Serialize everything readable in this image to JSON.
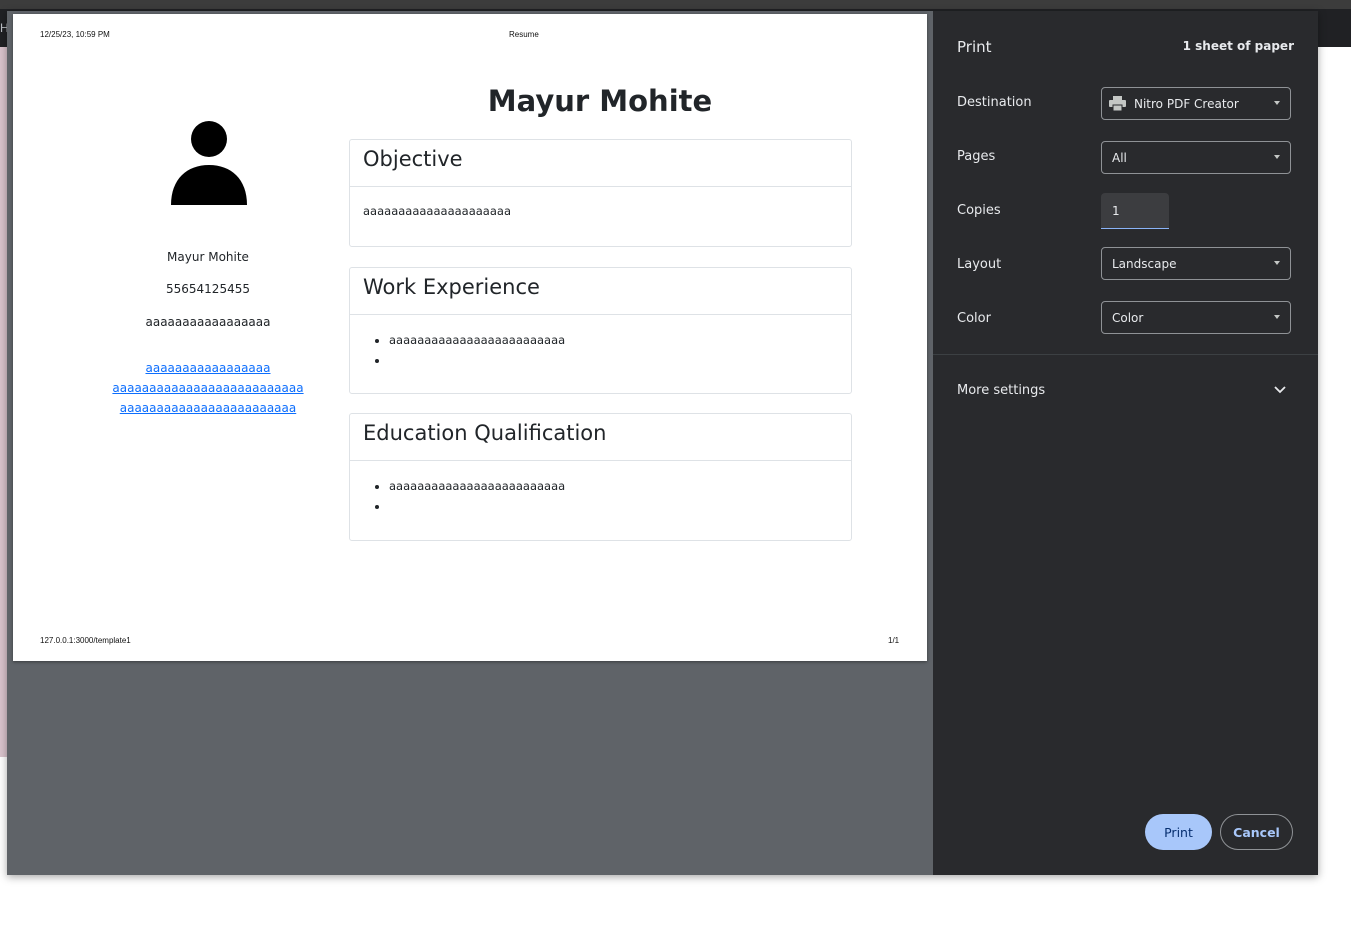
{
  "background": {
    "tab_fragment": "Hu"
  },
  "preview": {
    "header_date": "12/25/23, 10:59 PM",
    "header_title": "Resume",
    "footer_url": "127.0.0.1:3000/template1",
    "footer_page": "1/1",
    "resume": {
      "heading": "Mayur Mohite",
      "side_name": "Mayur Mohite",
      "phone": "55654125455",
      "side_text": "aaaaaaaaaaaaaaaaa",
      "links": [
        "aaaaaaaaaaaaaaaaa",
        "aaaaaaaaaaaaaaaaaaaaaaaaaa",
        "aaaaaaaaaaaaaaaaaaaaaaaa"
      ],
      "objective": {
        "title": "Objective",
        "text": "aaaaaaaaaaaaaaaaaaaaa"
      },
      "work": {
        "title": "Work Experience",
        "items": [
          "aaaaaaaaaaaaaaaaaaaaaaaaa",
          ""
        ]
      },
      "education": {
        "title": "Education Qualification",
        "items": [
          "aaaaaaaaaaaaaaaaaaaaaaaaa",
          ""
        ]
      }
    }
  },
  "panel": {
    "title": "Print",
    "sheets": "1 sheet of paper",
    "destination": {
      "label": "Destination",
      "value": "Nitro PDF Creator",
      "icon": "printer-icon"
    },
    "pages": {
      "label": "Pages",
      "value": "All"
    },
    "copies": {
      "label": "Copies",
      "value": "1"
    },
    "layout": {
      "label": "Layout",
      "value": "Landscape"
    },
    "color": {
      "label": "Color",
      "value": "Color"
    },
    "more_settings": "More settings",
    "print_button": "Print",
    "cancel_button": "Cancel"
  },
  "colors": {
    "panel_bg": "#292a2d",
    "preview_bg": "#5f6368",
    "primary_button": "#a8c7fa",
    "link": "#0d6efd"
  }
}
